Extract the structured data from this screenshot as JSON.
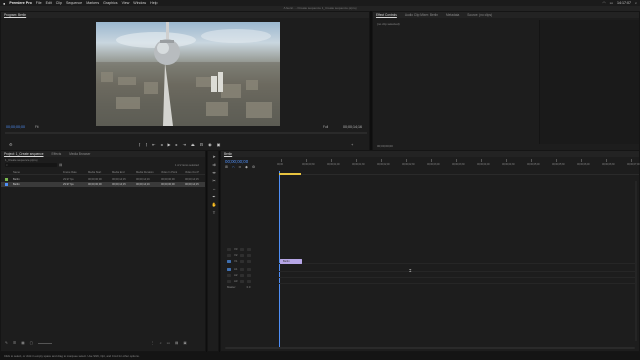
{
  "menubar": {
    "apple": "",
    "app_name": "Premiere Pro",
    "items": [
      "File",
      "Edit",
      "Clip",
      "Sequence",
      "Markers",
      "Graphics",
      "View",
      "Window",
      "Help"
    ],
    "clock": "14:17:07"
  },
  "window": {
    "title": "/Users/...../Create sequence 1_Create sequence.prproj"
  },
  "program_monitor": {
    "title": "Program: Berlin",
    "timecode_left": "00;00;00;00",
    "fit_label": "Fit",
    "quality_label": "Full",
    "timecode_right": "00;00;14;16"
  },
  "effect_panel": {
    "tabs": [
      "Effect Controls",
      "Audio Clip Mixer: Berlin",
      "Metadata",
      "Source: (no clips)"
    ],
    "active_tab": 0,
    "message": "(no clip selected)",
    "bottom_timecode": "00;00;00;00"
  },
  "project_panel": {
    "tabs": [
      "Project: 1_Create sequence",
      "Effects",
      "Media Browser"
    ],
    "active_tab": 0,
    "path": "1_Create sequence.prproj",
    "items_selected": "1 of 2 items selected",
    "columns": [
      "Name",
      "Frame Rate",
      "Media Start",
      "Media End",
      "Media Duration",
      "Video In Point",
      "Video Out P"
    ],
    "rows": [
      {
        "name": "Berlin",
        "frame_rate": "29.97 fps",
        "media_start": "00;00;00;00",
        "media_end": "00;00;14;15",
        "media_duration": "00;00;14;16",
        "video_in": "00;00;00;00",
        "video_out": "00;00;14;15",
        "color": "#7ab84e"
      },
      {
        "name": "Berlin",
        "frame_rate": "29.97 fps",
        "media_start": "00;00;00;00",
        "media_end": "00;00;14;15",
        "media_duration": "00;00;14;16",
        "video_in": "00;00;00;00",
        "video_out": "00;00;14;15",
        "color": "#4f8ff7",
        "selected": true
      }
    ]
  },
  "timeline": {
    "tab": "Berlin",
    "timecode": "00;00;00;00",
    "ruler_labels": [
      "00;00",
      "00;00;00;30",
      "00;00;01;00",
      "00;00;01;30",
      "00;00;02;00",
      "00;00;02;30",
      "00;00;03;00",
      "00;00;03;30",
      "00;00;04;00",
      "00;00;04;30",
      "00;00;05;00",
      "00;00;05;30",
      "00;00;06;00",
      "00;00;06;30",
      "00;00;07;00"
    ],
    "video_tracks": [
      "V3",
      "V2",
      "V1"
    ],
    "audio_tracks": [
      "A1",
      "A2",
      "A3"
    ],
    "master_label": "Master",
    "master_value": "0.0",
    "clip_label": "Berlin",
    "clip_color": "#b6a6e6"
  },
  "tools": [
    "selection",
    "track-select",
    "ripple-edit",
    "razor",
    "slip",
    "pen",
    "hand",
    "type"
  ],
  "status_bar": {
    "text": "Click to select, or click in empty space and drag to marquee select. Use Shift, Opt, and Cmd for other options."
  },
  "colors": {
    "accent_blue": "#4f8ff7",
    "playhead_yellow": "#e8c440",
    "clip_purple": "#b6a6e6"
  }
}
